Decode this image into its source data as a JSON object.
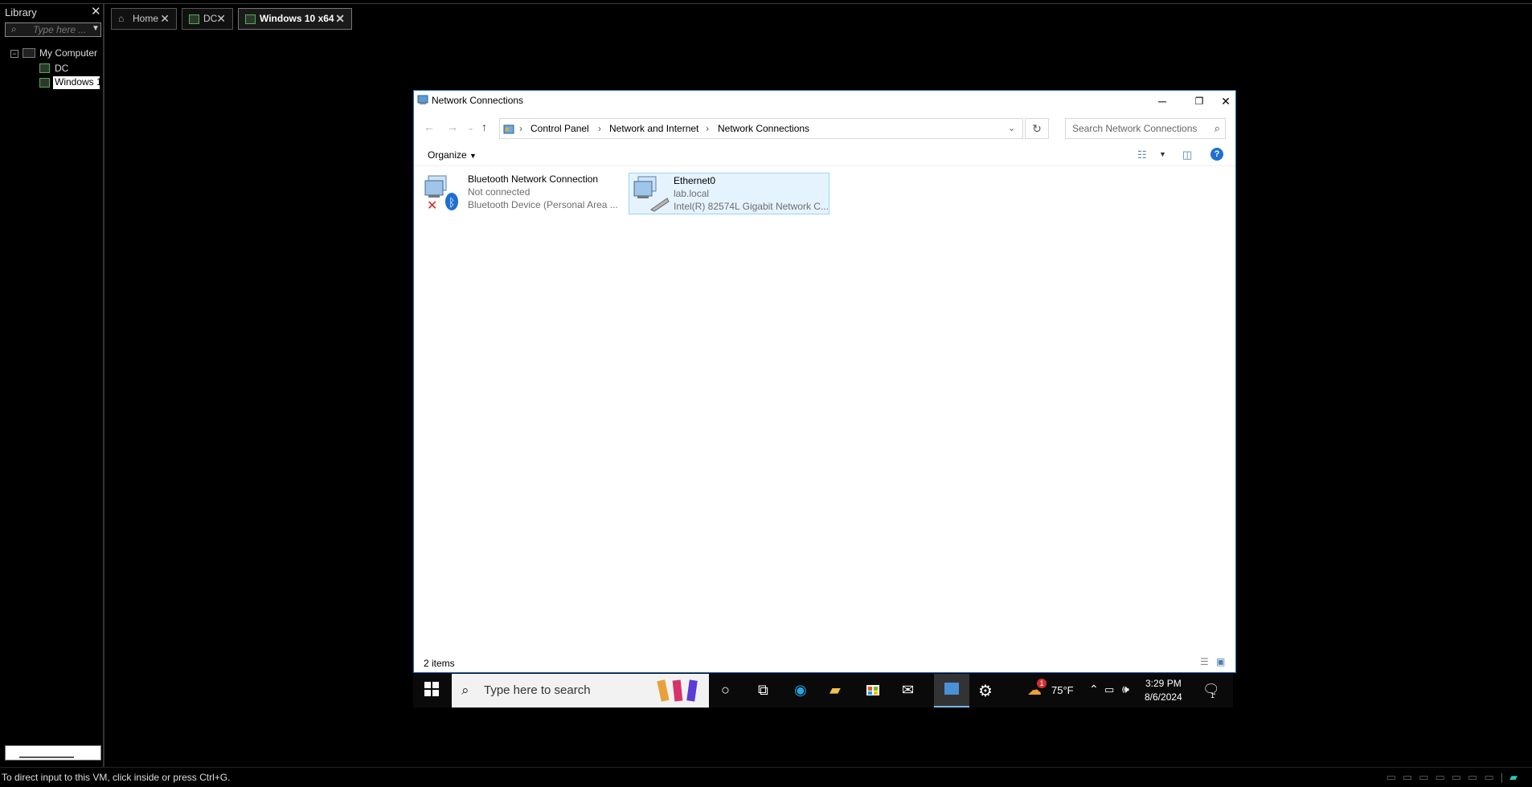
{
  "library": {
    "title": "Library",
    "search_placeholder": "Type here ...",
    "tree": {
      "root": "My Computer",
      "children": [
        "DC",
        "Windows 1"
      ]
    }
  },
  "tabs": [
    {
      "label": "Home"
    },
    {
      "label": "DC"
    },
    {
      "label": "Windows 10 x64"
    }
  ],
  "statusbar": {
    "text": "To direct input to this VM, click inside or press Ctrl+G."
  },
  "window": {
    "title": "Network Connections",
    "breadcrumb": [
      "Control Panel",
      "Network and Internet",
      "Network Connections"
    ],
    "search_placeholder": "Search Network Connections",
    "organize_label": "Organize",
    "items": [
      {
        "name": "Bluetooth Network Connection",
        "status": "Not connected",
        "device": "Bluetooth Device (Personal Area ..."
      },
      {
        "name": "Ethernet0",
        "status": "lab.local",
        "device": "Intel(R) 82574L Gigabit Network C..."
      }
    ],
    "item_count": "2 items"
  },
  "taskbar": {
    "search_placeholder": "Type here to search",
    "weather": "75°F",
    "time": "3:29 PM",
    "date": "8/6/2024",
    "notification_count": "1",
    "weather_badge": "1"
  }
}
